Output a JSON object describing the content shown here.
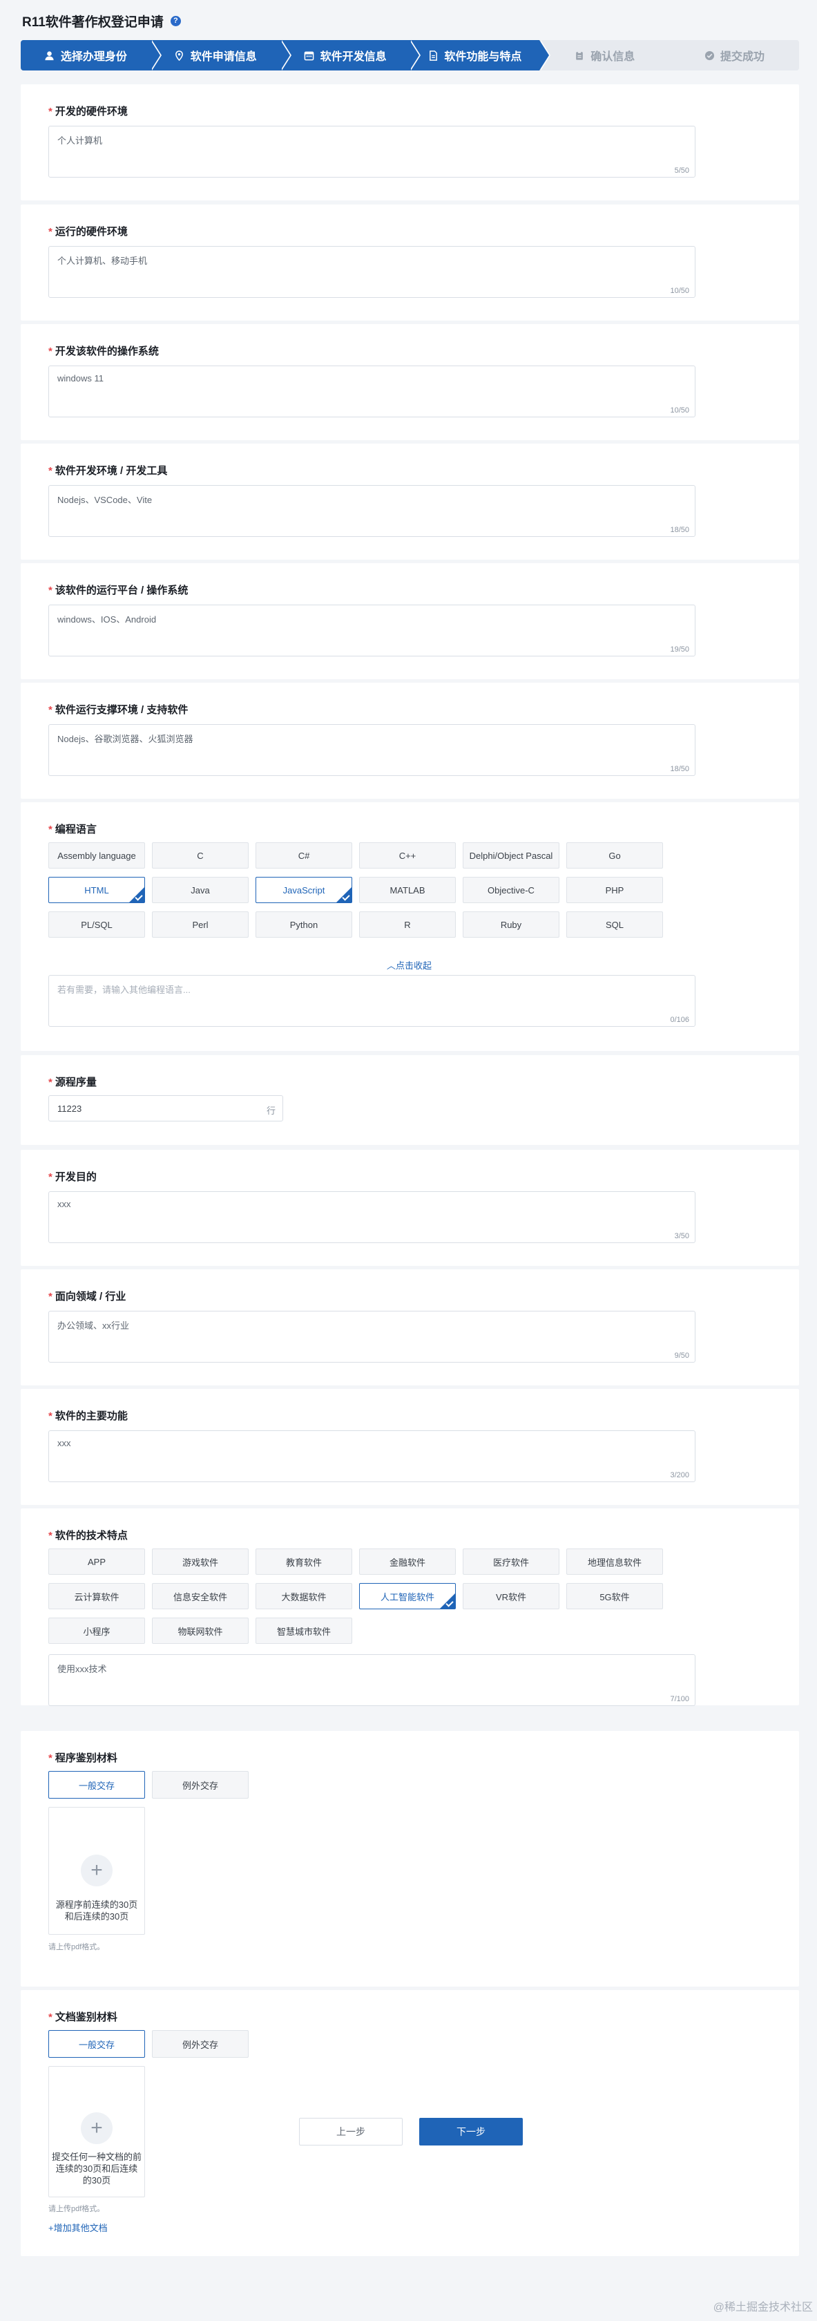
{
  "header": {
    "title": "R11软件著作权登记申请"
  },
  "steps": [
    {
      "label": "选择办理身份",
      "icon": "person-icon",
      "state": "done"
    },
    {
      "label": "软件申请信息",
      "icon": "location-icon",
      "state": "done"
    },
    {
      "label": "软件开发信息",
      "icon": "calendar-icon",
      "state": "done"
    },
    {
      "label": "软件功能与特点",
      "icon": "document-icon",
      "state": "done"
    },
    {
      "label": "确认信息",
      "icon": "clipboard-icon",
      "state": "pending"
    },
    {
      "label": "提交成功",
      "icon": "check-circle-icon",
      "state": "pending"
    }
  ],
  "sections": {
    "dev_hardware": {
      "label": "开发的硬件环境",
      "value": "个人计算机",
      "count": "5/50"
    },
    "run_hardware": {
      "label": "运行的硬件环境",
      "value": "个人计算机、移动手机",
      "count": "10/50"
    },
    "dev_os": {
      "label": "开发该软件的操作系统",
      "value": "windows 11",
      "count": "10/50"
    },
    "dev_tools": {
      "label": "软件开发环境 / 开发工具",
      "value": "Nodejs、VSCode、Vite",
      "count": "18/50"
    },
    "run_platform": {
      "label": "该软件的运行平台 / 操作系统",
      "value": "windows、IOS、Android",
      "count": "19/50"
    },
    "run_support": {
      "label": "软件运行支撑环境 / 支持软件",
      "value": "Nodejs、谷歌浏览器、火狐浏览器",
      "count": "18/50"
    },
    "languages": {
      "label": "编程语言",
      "options": [
        "Assembly language",
        "C",
        "C#",
        "C++",
        "Delphi/Object Pascal",
        "Go",
        "HTML",
        "Java",
        "JavaScript",
        "MATLAB",
        "Objective-C",
        "PHP",
        "PL/SQL",
        "Perl",
        "Python",
        "R",
        "Ruby",
        "SQL"
      ],
      "selected": [
        "HTML",
        "JavaScript"
      ],
      "collapse": "点击收起",
      "placeholder": "若有需要，请输入其他编程语言...",
      "count": "0/106"
    },
    "lines": {
      "label": "源程序量",
      "value": "11223",
      "unit": "行"
    },
    "purpose": {
      "label": "开发目的",
      "value": "xxx",
      "count": "3/50"
    },
    "domain": {
      "label": "面向领域 / 行业",
      "value": "办公领域、xx行业",
      "count": "9/50"
    },
    "function": {
      "label": "软件的主要功能",
      "value": "xxx",
      "count": "3/200"
    },
    "tech": {
      "label": "软件的技术特点",
      "options": [
        "APP",
        "游戏软件",
        "教育软件",
        "金融软件",
        "医疗软件",
        "地理信息软件",
        "云计算软件",
        "信息安全软件",
        "大数据软件",
        "人工智能软件",
        "VR软件",
        "5G软件",
        "小程序",
        "物联网软件",
        "智慧城市软件"
      ],
      "selected": [
        "人工智能软件"
      ],
      "value": "使用xxx技术",
      "count": "7/100"
    },
    "program_material": {
      "label": "程序鉴别材料",
      "tabs": [
        "一般交存",
        "例外交存"
      ],
      "upload_text": "源程序前连续的30页和后连续的30页",
      "hint": "请上传pdf格式。"
    },
    "doc_material": {
      "label": "文档鉴别材料",
      "tabs": [
        "一般交存",
        "例外交存"
      ],
      "upload_text": "提交任何一种文档的前连续的30页和后连续的30页",
      "hint": "请上传pdf格式。",
      "add_link": "+增加其他文档"
    }
  },
  "footer": {
    "prev": "上一步",
    "next": "下一步"
  },
  "watermark": "@稀土掘金技术社区"
}
